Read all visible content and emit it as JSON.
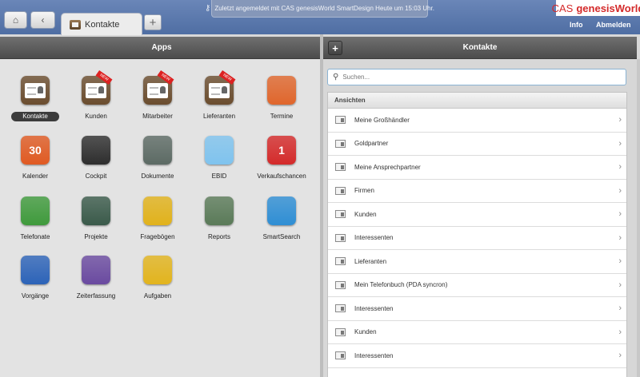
{
  "topbar": {
    "tab_label": "Kontakte",
    "add_tab": "+",
    "notice": "Zuletzt angemeldet mit CAS genesisWorld SmartDesign Heute um 15:03 Uhr.",
    "logo_a": "CAS",
    "logo_b": "genesisWorld",
    "info": "Info",
    "logout": "Abmelden"
  },
  "apps_panel": {
    "title": "Apps",
    "apps": [
      {
        "label": "Kontakte",
        "selected": true,
        "icon": "contacts-card-icon",
        "color": "#6b4d2f"
      },
      {
        "label": "Kunden",
        "icon": "customers-card-icon",
        "color": "#6b4d2f",
        "badge": "NEW"
      },
      {
        "label": "Mitarbeiter",
        "icon": "employees-card-icon",
        "color": "#6b4d2f",
        "badge": "NEW"
      },
      {
        "label": "Lieferanten",
        "icon": "suppliers-card-icon",
        "color": "#6b4d2f",
        "badge": "NEW"
      },
      {
        "label": "Termine",
        "icon": "clock-icon",
        "color": "#e0662c"
      },
      {
        "label": "Kalender",
        "icon": "calendar-icon",
        "color": "#e05a22",
        "glyph": "30"
      },
      {
        "label": "Cockpit",
        "icon": "pie-chart-icon",
        "color": "#2e2e2e"
      },
      {
        "label": "Dokumente",
        "icon": "document-icon",
        "color": "#5c6a64"
      },
      {
        "label": "EBID",
        "icon": "ebid-icon",
        "color": "#7fc3ee"
      },
      {
        "label": "Verkaufschancen",
        "icon": "sales-chance-icon",
        "color": "#d42a2a",
        "glyph": "1"
      },
      {
        "label": "Telefonate",
        "icon": "phone-icon",
        "color": "#3f9a3c"
      },
      {
        "label": "Projekte",
        "icon": "project-icon",
        "color": "#3a5a4a"
      },
      {
        "label": "Fragebögen",
        "icon": "questionnaire-icon",
        "color": "#e1b21b"
      },
      {
        "label": "Reports",
        "icon": "reports-icon",
        "color": "#5a7a58"
      },
      {
        "label": "SmartSearch",
        "icon": "search-icon",
        "color": "#2f8ed4"
      },
      {
        "label": "Vorgänge",
        "icon": "gear-icon",
        "color": "#2c63b8"
      },
      {
        "label": "Zeiterfassung",
        "icon": "stopwatch-icon",
        "color": "#6a4aa0"
      },
      {
        "label": "Aufgaben",
        "icon": "task-check-icon",
        "color": "#e2b41d"
      }
    ]
  },
  "contacts_panel": {
    "title": "Kontakte",
    "add": "+",
    "search_placeholder": "Suchen...",
    "section": "Ansichten",
    "items": [
      "Meine Großhändler",
      "Goldpartner",
      "Meine Ansprechpartner",
      "Firmen",
      "Kunden",
      "Interessenten",
      "Lieferanten",
      "Mein Telefonbuch (PDA syncron)",
      "Interessenten",
      "Kunden",
      "Interessenten"
    ]
  }
}
